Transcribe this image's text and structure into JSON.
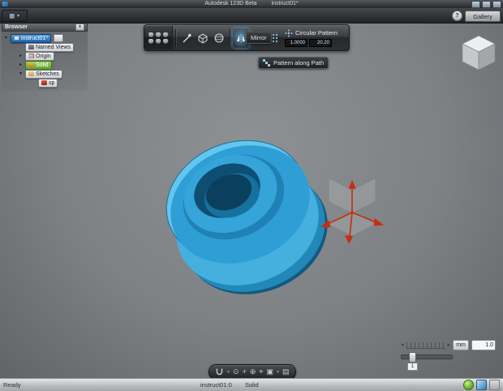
{
  "window": {
    "app_title": "Autodesk 123D Beta",
    "doc_title": "instruct01*"
  },
  "topbar": {
    "gallery": "Gallery",
    "help": "?"
  },
  "flyout": {
    "rectangular_pattern": "Rectangular Pattern",
    "mirror": "Mirror",
    "circular_pattern": "Circular Pattern",
    "pattern_along_path": "Pattern along Path",
    "value1": "1.0000",
    "value2": "20.20"
  },
  "browser": {
    "header": "Browser",
    "items": [
      {
        "label": "instruct01*"
      },
      {
        "label": "Named Views"
      },
      {
        "label": "Origin"
      },
      {
        "label": "Solid"
      },
      {
        "label": "Sketches"
      },
      {
        "label": "sp"
      }
    ]
  },
  "scale_widget": {
    "unit": "mm",
    "value": "1.0",
    "slider_value": "1"
  },
  "statusbar": {
    "left": "Ready",
    "doc": "instruct01:0",
    "mode": "Solid"
  },
  "colors": {
    "model_blue": "#2f9ed5",
    "selection_blue": "#1d62ac",
    "solid_green": "#5da32c",
    "axis_red": "#c62e14",
    "toolbar_dark": "#26282b"
  }
}
